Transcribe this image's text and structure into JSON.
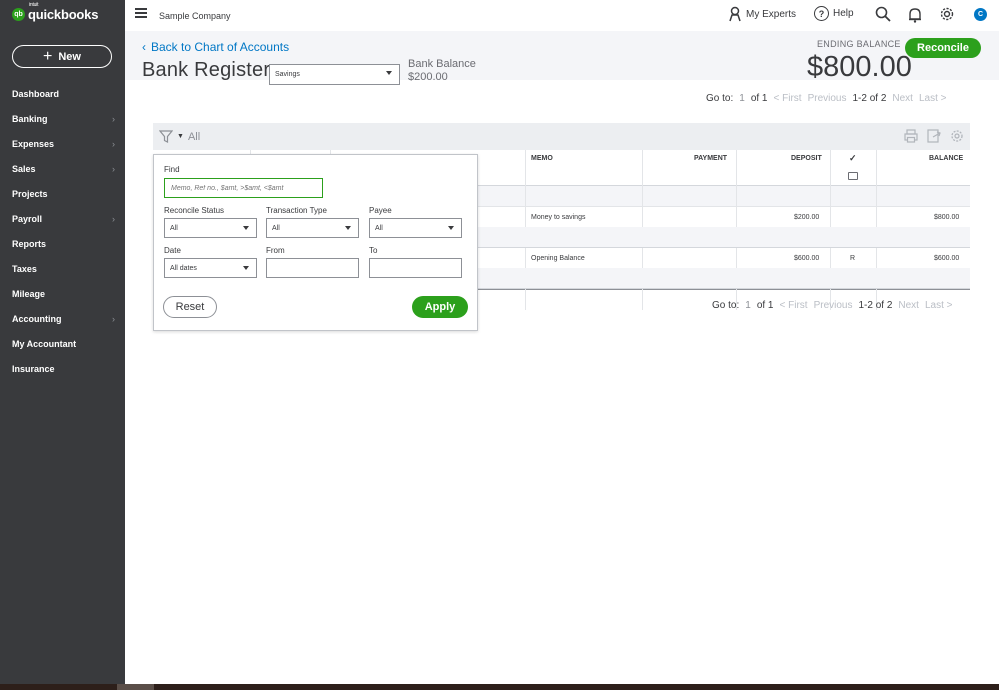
{
  "app": {
    "logo_small": "intuit",
    "logo": "quickbooks",
    "logo_badge": "qb"
  },
  "sidebar": {
    "new_label": "New",
    "items": [
      {
        "label": "Dashboard",
        "chevron": false
      },
      {
        "label": "Banking",
        "chevron": true
      },
      {
        "label": "Expenses",
        "chevron": true
      },
      {
        "label": "Sales",
        "chevron": true
      },
      {
        "label": "Projects",
        "chevron": false
      },
      {
        "label": "Payroll",
        "chevron": true
      },
      {
        "label": "Reports",
        "chevron": false
      },
      {
        "label": "Taxes",
        "chevron": false
      },
      {
        "label": "Mileage",
        "chevron": false
      },
      {
        "label": "Accounting",
        "chevron": true
      },
      {
        "label": "My Accountant",
        "chevron": false
      },
      {
        "label": "Insurance",
        "chevron": false
      }
    ]
  },
  "topbar": {
    "company": "Sample Company",
    "experts": "My Experts",
    "help": "Help",
    "help_glyph": "?",
    "avatar": "C"
  },
  "header": {
    "back_link": "Back to Chart of Accounts",
    "back_arrow": "‹",
    "title": "Bank Register",
    "account": "Savings",
    "bank_balance_label": "Bank Balance",
    "bank_balance": "$200.00",
    "ending_balance_label": "ENDING BALANCE",
    "ending_balance": "$800.00",
    "reconcile": "Reconcile"
  },
  "pager": {
    "goto": "Go to:",
    "page": "1",
    "of": "of 1",
    "first": "< First",
    "previous": "Previous",
    "range": "1-2 of 2",
    "next": "Next",
    "last": "Last >"
  },
  "toolbar": {
    "filter_value": "All"
  },
  "table": {
    "headers": {
      "memo": "MEMO",
      "payment": "PAYMENT",
      "deposit": "DEPOSIT",
      "reconcile_check": "✓",
      "balance": "BALANCE"
    },
    "rows": [
      {
        "memo": "Money to savings",
        "payment": "",
        "deposit": "$200.00",
        "status": "",
        "balance": "$800.00"
      },
      {
        "memo": "Opening Balance",
        "payment": "",
        "deposit": "$600.00",
        "status": "R",
        "balance": "$600.00"
      }
    ]
  },
  "filter": {
    "find_label": "Find",
    "find_placeholder": "Memo, Ref no., $amt, >$amt, <$amt",
    "reconcile_status_label": "Reconcile Status",
    "reconcile_status_value": "All",
    "transaction_type_label": "Transaction Type",
    "transaction_type_value": "All",
    "payee_label": "Payee",
    "payee_value": "All",
    "date_label": "Date",
    "date_value": "All dates",
    "from_label": "From",
    "to_label": "To",
    "reset": "Reset",
    "apply": "Apply"
  },
  "colors": {
    "brand_green": "#2ca01c",
    "link_blue": "#0077c5",
    "sidebar_bg": "#393a3d"
  }
}
